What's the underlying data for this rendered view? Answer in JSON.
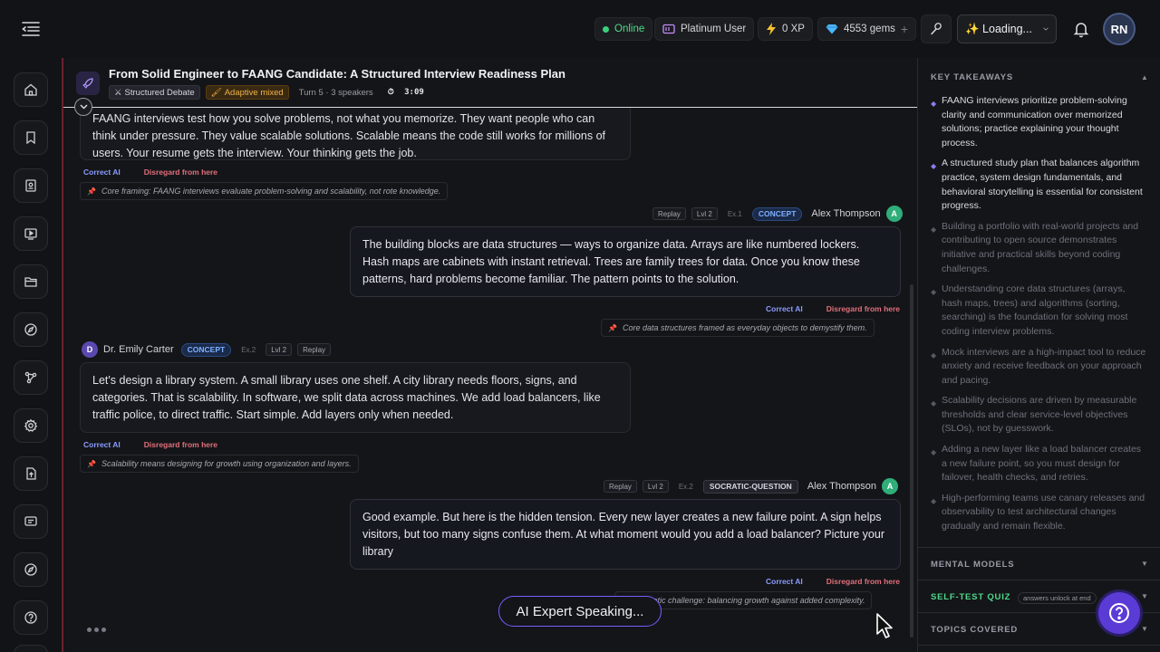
{
  "topbar": {
    "status": "Online",
    "plan": "Platinum User",
    "xp": "0 XP",
    "gems": "4553 gems",
    "gems_plus": "+",
    "loading": "✨ Loading...",
    "avatar_initials": "RN"
  },
  "session": {
    "title": "From Solid Engineer to FAANG Candidate: A Structured Interview Readiness Plan",
    "mode": "Structured Debate",
    "adaptive": "Adaptive mixed",
    "turn_info": "Turn 5 · 3 speakers",
    "timer": "3:09"
  },
  "messages": [
    {
      "text": "FAANG interviews test how you solve problems, not what you memorize. They want people who can think under pressure. They value scalable solutions. Scalable means the code still works for millions of users. Your resume gets the interview. Your thinking gets the job.",
      "note": "Core framing: FAANG interviews evaluate problem-solving and scalability, not rote knowledge."
    },
    {
      "speaker": "Alex Thompson",
      "initial": "A",
      "badge": "CONCEPT",
      "ex": "Ex.1",
      "lvl": "Lvl 2",
      "replay": "Replay",
      "text": "The building blocks are data structures — ways to organize data. Arrays are like numbered lockers. Hash maps are cabinets with instant retrieval. Trees are family trees for data. Once you know these patterns, hard problems become familiar. The pattern points to the solution.",
      "note": "Core data structures framed as everyday objects to demystify them."
    },
    {
      "speaker": "Dr. Emily Carter",
      "initial": "D",
      "badge": "CONCEPT",
      "ex": "Ex.2",
      "lvl": "Lvl 2",
      "replay": "Replay",
      "text": "Let's design a library system. A small library uses one shelf. A city library needs floors, signs, and categories. That is scalability. In software, we split data across machines. We add load balancers, like traffic police, to direct traffic. Start simple. Add layers only when needed.",
      "note": "Scalability means designing for growth using organization and layers."
    },
    {
      "speaker": "Alex Thompson",
      "initial": "A",
      "badge": "SOCRATIC-QUESTION",
      "ex": "Ex.2",
      "lvl": "Lvl 2",
      "replay": "Replay",
      "text": "Good example. But here is the hidden tension. Every new layer creates a new failure point. A sign helps visitors, but too many signs confuse them. At what moment would you add a load balancer? Picture your library",
      "note": "Socratic challenge: balancing growth against added complexity."
    }
  ],
  "actions": {
    "correct": "Correct AI",
    "disregard": "Disregard from here"
  },
  "speaking": "AI Expert Speaking...",
  "panel": {
    "key_takeaways": "KEY TAKEAWAYS",
    "takeaways": [
      "FAANG interviews prioritize problem-solving clarity and communication over memorized solutions; practice explaining your thought process.",
      "A structured study plan that balances algorithm practice, system design fundamentals, and behavioral storytelling is essential for consistent progress.",
      "Building a portfolio with real-world projects and contributing to open source demonstrates initiative and practical skills beyond coding challenges.",
      "Understanding core data structures (arrays, hash maps, trees) and algorithms (sorting, searching) is the foundation for solving most coding interview problems.",
      "Mock interviews are a high-impact tool to reduce anxiety and receive feedback on your approach and pacing.",
      "Scalability decisions are driven by measurable thresholds and clear service-level objectives (SLOs), not by guesswork.",
      "Adding a new layer like a load balancer creates a new failure point, so you must design for failover, health checks, and retries.",
      "High-performing teams use canary releases and observability to test architectural changes gradually and remain flexible."
    ],
    "mental_models": "MENTAL MODELS",
    "self_test": "SELF-TEST QUIZ",
    "self_test_hint": "answers unlock at end",
    "topics": "TOPICS COVERED"
  }
}
